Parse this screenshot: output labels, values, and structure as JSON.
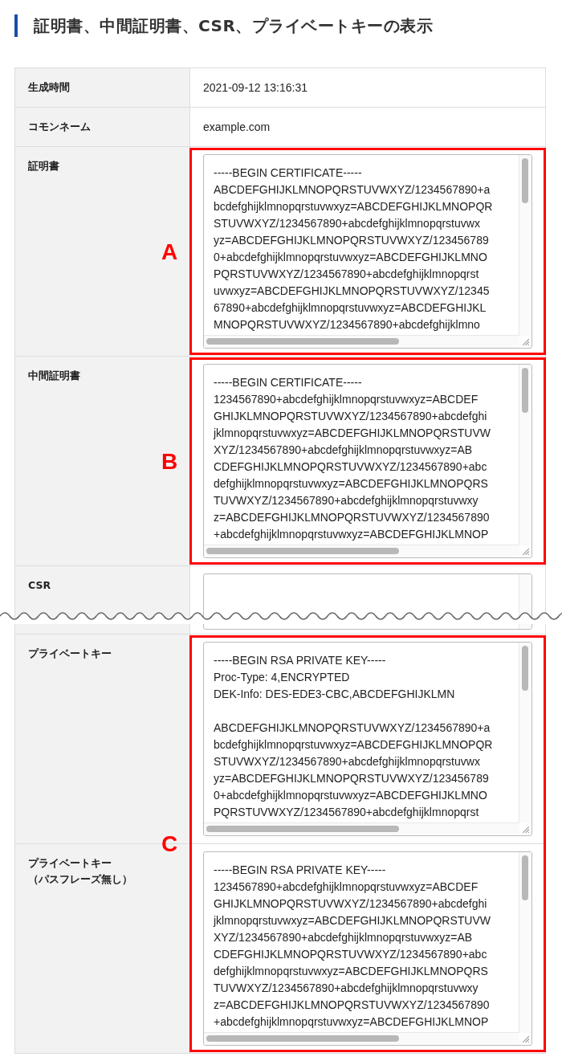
{
  "title": "証明書、中間証明書、CSR、プライベートキーの表示",
  "sections": [
    {
      "rows": [
        {
          "label": "生成時間",
          "kind": "text",
          "value": "2021-09-12 13:16:31"
        },
        {
          "label": "コモンネーム",
          "kind": "text",
          "value": "example.com"
        }
      ]
    },
    {
      "annotation": {
        "label": "A"
      },
      "rows": [
        {
          "label": "証明書",
          "kind": "textarea",
          "blocks": [
            [
              "-----BEGIN CERTIFICATE-----",
              "ABCDEFGHIJKLMNOPQRSTUVWXYZ/1234567890+a",
              "bcdefghijklmnopqrstuvwxyz=ABCDEFGHIJKLMNOPQR",
              "STUVWXYZ/1234567890+abcdefghijklmnopqrstuvwx",
              "yz=ABCDEFGHIJKLMNOPQRSTUVWXYZ/123456789",
              "0+abcdefghijklmnopqrstuvwxyz=ABCDEFGHIJKLMNO",
              "PQRSTUVWXYZ/1234567890+abcdefghijklmnopqrst",
              "uvwxyz=ABCDEFGHIJKLMNOPQRSTUVWXYZ/12345",
              "67890+abcdefghijklmnopqrstuvwxyz=ABCDEFGHIJKL",
              "MNOPQRSTUVWXYZ/1234567890+abcdefghijklmno"
            ]
          ]
        }
      ]
    },
    {
      "annotation": {
        "label": "B"
      },
      "rows": [
        {
          "label": "中間証明書",
          "kind": "textarea",
          "blocks": [
            [
              "-----BEGIN CERTIFICATE-----",
              "1234567890+abcdefghijklmnopqrstuvwxyz=ABCDEF",
              "GHIJKLMNOPQRSTUVWXYZ/1234567890+abcdefghi",
              "jklmnopqrstuvwxyz=ABCDEFGHIJKLMNOPQRSTUVW",
              "XYZ/1234567890+abcdefghijklmnopqrstuvwxyz=AB",
              "CDEFGHIJKLMNOPQRSTUVWXYZ/1234567890+abc",
              "defghijklmnopqrstuvwxyz=ABCDEFGHIJKLMNOPQRS",
              "TUVWXYZ/1234567890+abcdefghijklmnopqrstuvwxy",
              "z=ABCDEFGHIJKLMNOPQRSTUVWXYZ/1234567890",
              "+abcdefghijklmnopqrstuvwxyz=ABCDEFGHIJKLMNOP"
            ]
          ]
        }
      ]
    },
    {
      "rows": [
        {
          "label": "CSR",
          "kind": "textarea",
          "cut": true
        }
      ]
    },
    {
      "annotation": {
        "label": "C"
      },
      "rows": [
        {
          "label": "プライベートキー",
          "kind": "textarea",
          "blocks": [
            [
              "-----BEGIN RSA PRIVATE KEY-----",
              "Proc-Type: 4,ENCRYPTED",
              "DEK-Info: DES-EDE3-CBC,ABCDEFGHIJKLMN"
            ],
            [
              "ABCDEFGHIJKLMNOPQRSTUVWXYZ/1234567890+a",
              "bcdefghijklmnopqrstuvwxyz=ABCDEFGHIJKLMNOPQR",
              "STUVWXYZ/1234567890+abcdefghijklmnopqrstuvwx",
              "yz=ABCDEFGHIJKLMNOPQRSTUVWXYZ/123456789",
              "0+abcdefghijklmnopqrstuvwxyz=ABCDEFGHIJKLMNO",
              "PQRSTUVWXYZ/1234567890+abcdefghijklmnopqrst"
            ]
          ]
        },
        {
          "label": "プライベートキー",
          "sublabel": "（パスフレーズ無し）",
          "kind": "textarea",
          "blocks": [
            [
              "-----BEGIN RSA PRIVATE KEY-----",
              "1234567890+abcdefghijklmnopqrstuvwxyz=ABCDEF",
              "GHIJKLMNOPQRSTUVWXYZ/1234567890+abcdefghi",
              "jklmnopqrstuvwxyz=ABCDEFGHIJKLMNOPQRSTUVW",
              "XYZ/1234567890+abcdefghijklmnopqrstuvwxyz=AB",
              "CDEFGHIJKLMNOPQRSTUVWXYZ/1234567890+abc",
              "defghijklmnopqrstuvwxyz=ABCDEFGHIJKLMNOPQRS",
              "TUVWXYZ/1234567890+abcdefghijklmnopqrstuvwxy",
              "z=ABCDEFGHIJKLMNOPQRSTUVWXYZ/1234567890",
              "+abcdefghijklmnopqrstuvwxyz=ABCDEFGHIJKLMNOP"
            ]
          ]
        }
      ]
    }
  ]
}
